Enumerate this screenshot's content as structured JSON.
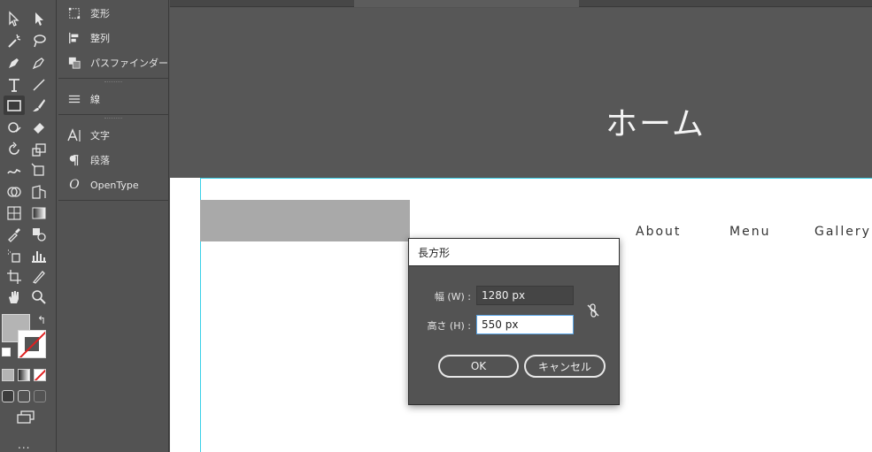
{
  "panel": {
    "items": [
      {
        "label": "変形",
        "icon": "transform-icon"
      },
      {
        "label": "整列",
        "icon": "align-icon"
      },
      {
        "label": "パスファインダー",
        "icon": "pathfinder-icon"
      },
      {
        "label": "線",
        "icon": "stroke-icon"
      },
      {
        "label": "文字",
        "icon": "character-icon"
      },
      {
        "label": "段落",
        "icon": "paragraph-icon"
      },
      {
        "label": "OpenType",
        "icon": "opentype-icon"
      }
    ]
  },
  "canvas": {
    "hero_title": "ホーム",
    "nav": [
      "About",
      "Menu",
      "Gallery"
    ]
  },
  "dialog": {
    "title": "長方形",
    "width_label": "幅 (W) :",
    "width_value": "1280 px",
    "height_label": "高さ (H) :",
    "height_value": "550 px",
    "ok_label": "OK",
    "cancel_label": "キャンセル"
  },
  "toolbar": {
    "more_label": "..."
  },
  "colors": {
    "ui_bg": "#535353",
    "artboard_guide": "#38d0e8",
    "focus_border": "#5aa6e8",
    "fill": "#b4b4b4",
    "none_stroke": "#e02020"
  }
}
